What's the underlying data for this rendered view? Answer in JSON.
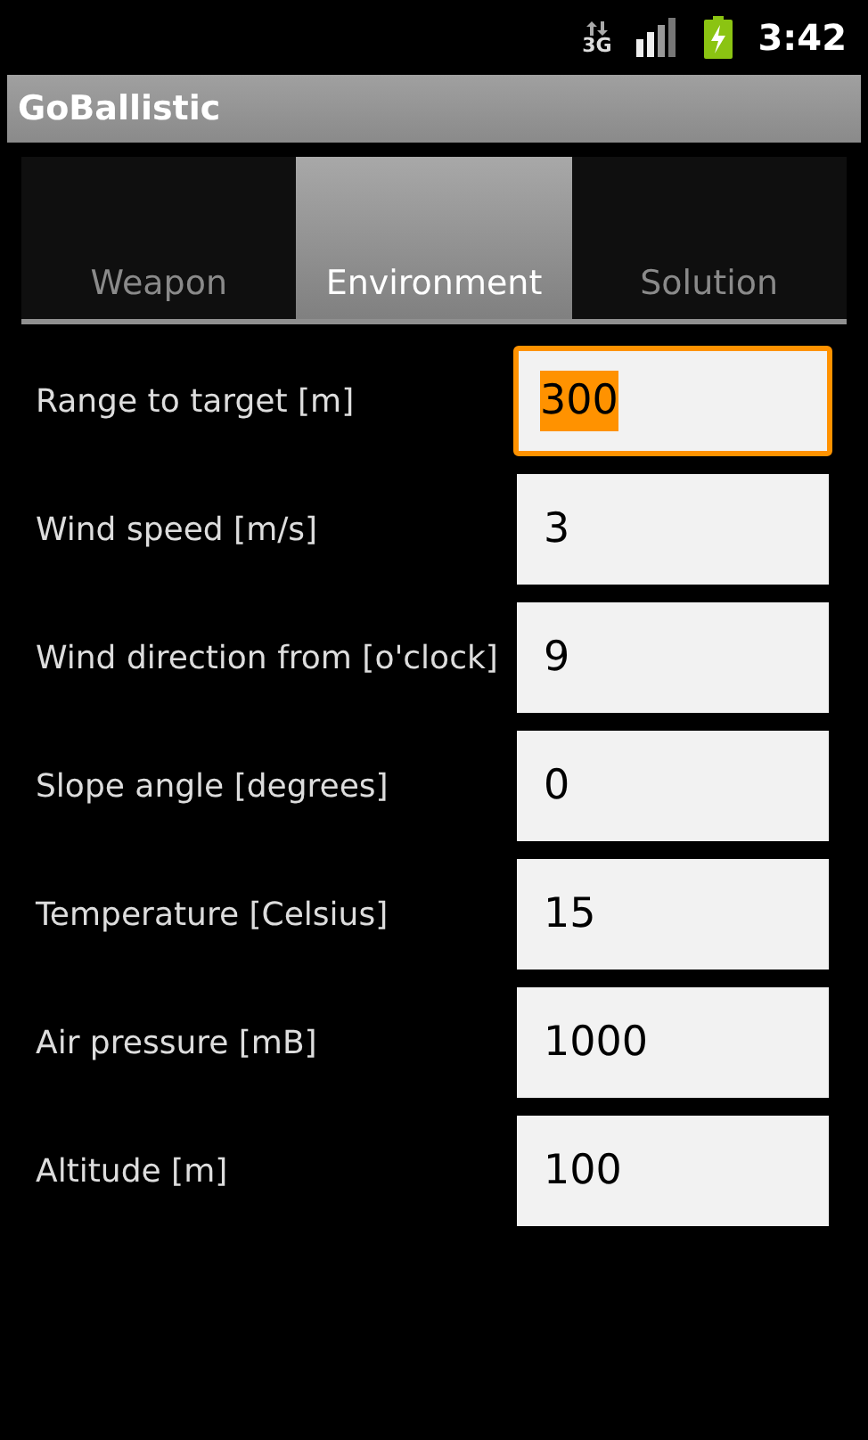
{
  "status_bar": {
    "network": "3G",
    "time": "3:42"
  },
  "app_bar": {
    "title": "GoBallistic"
  },
  "tabs": [
    {
      "label": "Weapon",
      "selected": false
    },
    {
      "label": "Environment",
      "selected": true
    },
    {
      "label": "Solution",
      "selected": false
    }
  ],
  "fields": [
    {
      "label": "Range to target [m]",
      "value": "300",
      "focused": true
    },
    {
      "label": "Wind speed [m/s]",
      "value": "3",
      "focused": false
    },
    {
      "label": "Wind direction from [o'clock]",
      "value": "9",
      "focused": false
    },
    {
      "label": "Slope angle [degrees]",
      "value": "0",
      "focused": false
    },
    {
      "label": "Temperature [Celsius]",
      "value": "15",
      "focused": false
    },
    {
      "label": "Air pressure [mB]",
      "value": "1000",
      "focused": false
    },
    {
      "label": "Altitude [m]",
      "value": "100",
      "focused": false
    }
  ]
}
